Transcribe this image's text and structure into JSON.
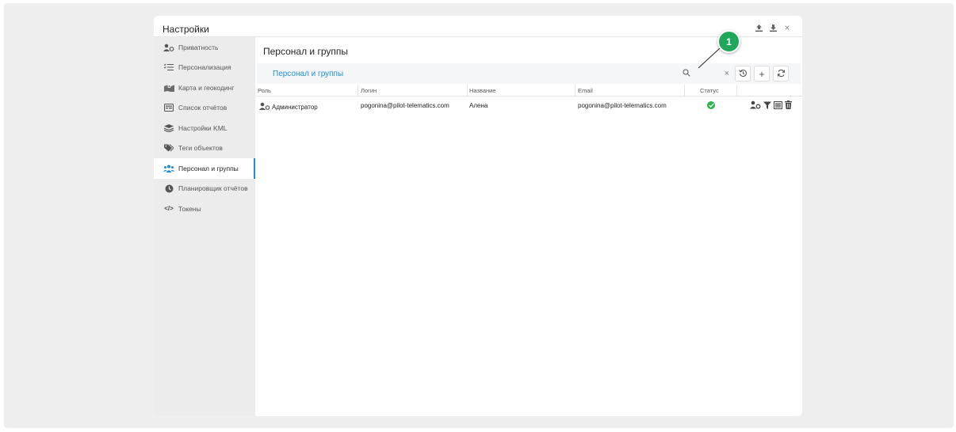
{
  "window": {
    "title": "Настройки",
    "actions": [
      "upload-icon",
      "download-icon",
      "close-icon"
    ],
    "close_label": "×"
  },
  "sidebar": {
    "items": [
      {
        "label": "Приватность",
        "icon": "user-privacy-icon",
        "active": false
      },
      {
        "label": "Персонализация",
        "icon": "list-checks-icon",
        "active": false
      },
      {
        "label": "Карта и геокодинг",
        "icon": "map-icon",
        "active": false
      },
      {
        "label": "Список отчётов",
        "icon": "report-list-icon",
        "active": false
      },
      {
        "label": "Настройки KML",
        "icon": "layers-icon",
        "active": false
      },
      {
        "label": "Теги объектов",
        "icon": "tags-icon",
        "active": false
      },
      {
        "label": "Персонал и группы",
        "icon": "users-icon",
        "active": true
      },
      {
        "label": "Планировщик отчётов",
        "icon": "clock-icon",
        "active": false
      },
      {
        "label": "Токены",
        "icon": "code-icon",
        "active": false
      }
    ],
    "code_glyph": "</>"
  },
  "main": {
    "heading": "Персонал и группы",
    "subtitle": "Персонал и группы",
    "search": {
      "placeholder": "",
      "clear": "×"
    },
    "toolbar": {
      "history_icon": "history-icon",
      "add_label": "+",
      "refresh_icon": "refresh-icon"
    }
  },
  "table": {
    "columns": [
      "Роль",
      "Логин",
      "Название",
      "Email",
      "Статус"
    ],
    "rows": [
      {
        "role": "Администратор",
        "login": "pogonina@pilot-telematics.com",
        "name": "Алена",
        "email": "pogonina@pilot-telematics.com",
        "status": "active"
      }
    ],
    "row_actions": [
      "user-settings-icon",
      "filter-icon",
      "list-icon",
      "trash-icon"
    ]
  },
  "annotation": {
    "number": "1"
  },
  "colors": {
    "accent": "#1a8fd6",
    "status_ok": "#2bb24c",
    "callout": "#1fa85a"
  }
}
